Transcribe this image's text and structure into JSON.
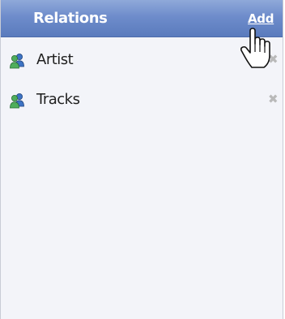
{
  "panel": {
    "title": "Relations",
    "add_label": "Add"
  },
  "relations": [
    {
      "label": "Artist",
      "icon": "users-icon",
      "remove_icon": "close-icon",
      "remove_glyph": "✖"
    },
    {
      "label": "Tracks",
      "icon": "users-icon",
      "remove_icon": "close-icon",
      "remove_glyph": "✖"
    }
  ],
  "colors": {
    "header_top": "#8fa9d9",
    "header_bottom": "#5a7bbd",
    "panel_bg": "#f3f4f9",
    "icon_green": "#3f9a4f",
    "icon_blue": "#3d73c4",
    "remove_gray": "#b9b9b9"
  }
}
